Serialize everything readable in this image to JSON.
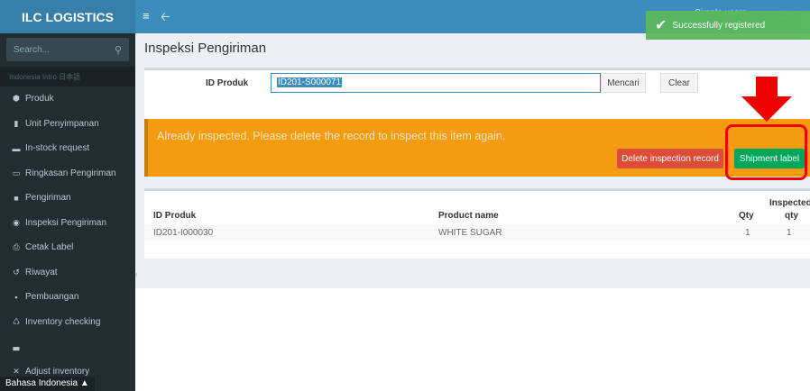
{
  "brand": "ILC LOGISTICS",
  "search": {
    "placeholder": "Search..."
  },
  "sidebar": {
    "header": "Indonesia Intro 日本語",
    "items": [
      {
        "label": "Produk",
        "icon": "cube-icon",
        "glyph": "⬢"
      },
      {
        "label": "Unit Penyimpanan",
        "icon": "book-icon",
        "glyph": "▮"
      },
      {
        "label": "In-stock request",
        "icon": "inbox-icon",
        "glyph": "▬"
      },
      {
        "label": "Ringkasan Pengiriman",
        "icon": "calendar-icon",
        "glyph": "▭"
      },
      {
        "label": "Pengiriman",
        "icon": "truck-icon",
        "glyph": "■"
      },
      {
        "label": "Inspeksi Pengiriman",
        "icon": "eye-icon",
        "glyph": "◉"
      },
      {
        "label": "Cetak Label",
        "icon": "print-icon",
        "glyph": "⎙"
      },
      {
        "label": "Riwayat",
        "icon": "history-icon",
        "glyph": "↺"
      },
      {
        "label": "Pembuangan",
        "icon": "trash-icon",
        "glyph": "▪"
      },
      {
        "label": "Inventory checking",
        "icon": "recycle-icon",
        "glyph": "♺"
      },
      {
        "label": "",
        "icon": "area-chart-icon",
        "glyph": "▃"
      },
      {
        "label": "Adjust inventory",
        "icon": "wrench-icon",
        "glyph": "✕"
      }
    ],
    "language": "Bahasa Indonesia ▲"
  },
  "navbar": {
    "user": "Simple users"
  },
  "toast": {
    "message": "Successfully registered"
  },
  "page": {
    "title": "Inspeksi Pengiriman"
  },
  "form": {
    "id_label": "ID Produk",
    "id_value": "ID201-S000071",
    "search_button": "Mencari",
    "clear_button": "Clear"
  },
  "alert": {
    "message": "Already inspected. Please delete the record to inspect this item again.",
    "delete_button": "Delete inspection record",
    "shipment_button": "Shipment label"
  },
  "table": {
    "headers": [
      "ID Produk",
      "Product name",
      "Qty",
      "Inspected",
      "qty"
    ],
    "rows": [
      {
        "id": "ID201-I000030",
        "name": "WHITE SUGAR",
        "qty": "1",
        "inspected": "1"
      }
    ]
  },
  "colors": {
    "sidebar": "#222d32",
    "brand": "#367fa9",
    "navbar": "#3c8dbc",
    "alert": "#f39c12",
    "danger": "#dd4b39",
    "success": "#00a65a"
  }
}
